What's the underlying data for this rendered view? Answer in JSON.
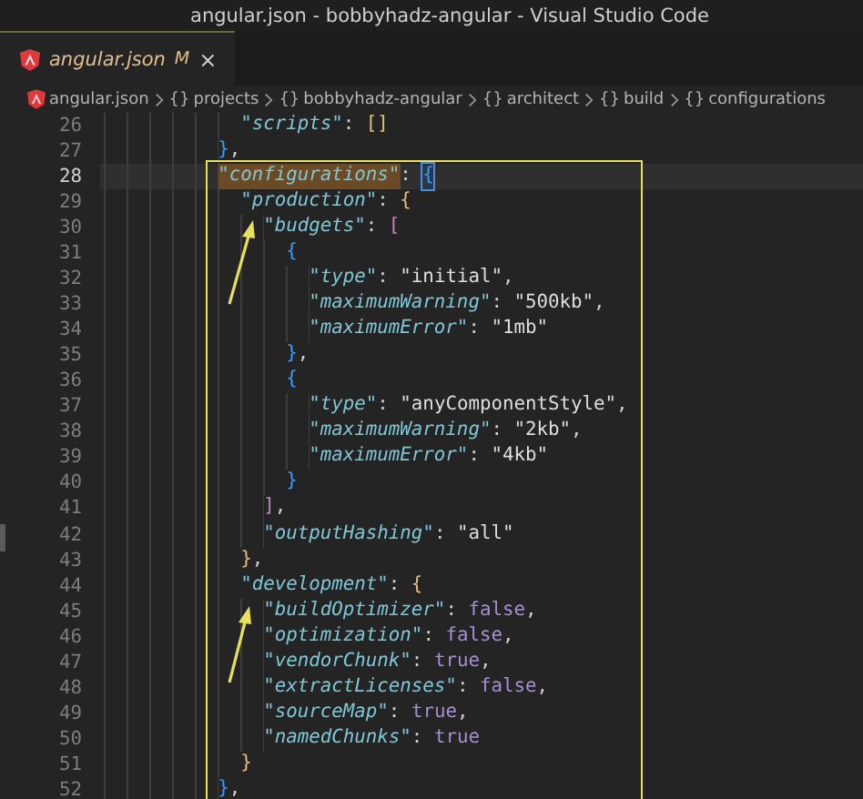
{
  "window": {
    "title": "angular.json - bobbyhadz-angular - Visual Studio Code"
  },
  "tabs": [
    {
      "label": "angular.json",
      "status": "M",
      "close": "×",
      "selected": true,
      "modified": true
    }
  ],
  "breadcrumbs": [
    {
      "kind": "file",
      "label": "angular.json"
    },
    {
      "kind": "symbol",
      "symbol": "{}",
      "label": "projects"
    },
    {
      "kind": "symbol",
      "symbol": "{}",
      "label": "bobbyhadz-angular"
    },
    {
      "kind": "symbol",
      "symbol": "{}",
      "label": "architect"
    },
    {
      "kind": "symbol",
      "symbol": "{}",
      "label": "build"
    },
    {
      "kind": "symbol",
      "symbol": "{}",
      "label": "configurations"
    }
  ],
  "editor": {
    "lines": [
      {
        "number": "26",
        "current": false,
        "tokens": [
          {
            "kind": "key",
            "text": "            \"scripts\""
          },
          {
            "kind": "punct",
            "text": ": "
          },
          {
            "kind": "bracket",
            "text": "[]",
            "color": "#e5c07b"
          }
        ]
      },
      {
        "number": "27",
        "current": false,
        "tokens": [
          {
            "kind": "bracket",
            "text": "          }",
            "color": "#3b9cff"
          },
          {
            "kind": "punct",
            "text": ","
          }
        ]
      },
      {
        "number": "28",
        "current": true,
        "tokens": [
          {
            "kind": "match",
            "text": "          \"configurations\""
          },
          {
            "kind": "punct",
            "text": ": "
          },
          {
            "kind": "cursor",
            "text": "{",
            "color": "#3b9cff"
          }
        ]
      },
      {
        "number": "29",
        "current": false,
        "tokens": [
          {
            "kind": "key",
            "text": "            \"production\""
          },
          {
            "kind": "punct",
            "text": ": "
          },
          {
            "kind": "bracket",
            "text": "{",
            "color": "#e5c07b"
          }
        ]
      },
      {
        "number": "30",
        "current": false,
        "tokens": [
          {
            "kind": "key",
            "text": "              \"budgets\""
          },
          {
            "kind": "punct",
            "text": ": "
          },
          {
            "kind": "bracket",
            "text": "[",
            "color": "#c586c0"
          }
        ]
      },
      {
        "number": "31",
        "current": false,
        "tokens": [
          {
            "kind": "bracket",
            "text": "                {",
            "color": "#3b9cff"
          }
        ]
      },
      {
        "number": "32",
        "current": false,
        "tokens": [
          {
            "kind": "key",
            "text": "                  \"type\""
          },
          {
            "kind": "punct",
            "text": ": "
          },
          {
            "kind": "string",
            "text": "\"initial\""
          },
          {
            "kind": "punct",
            "text": ","
          }
        ]
      },
      {
        "number": "33",
        "current": false,
        "tokens": [
          {
            "kind": "key",
            "text": "                  \"maximumWarning\""
          },
          {
            "kind": "punct",
            "text": ": "
          },
          {
            "kind": "string",
            "text": "\"500kb\""
          },
          {
            "kind": "punct",
            "text": ","
          }
        ]
      },
      {
        "number": "34",
        "current": false,
        "tokens": [
          {
            "kind": "key",
            "text": "                  \"maximumError\""
          },
          {
            "kind": "punct",
            "text": ": "
          },
          {
            "kind": "string",
            "text": "\"1mb\""
          }
        ]
      },
      {
        "number": "35",
        "current": false,
        "tokens": [
          {
            "kind": "bracket",
            "text": "                }",
            "color": "#3b9cff"
          },
          {
            "kind": "punct",
            "text": ","
          }
        ]
      },
      {
        "number": "36",
        "current": false,
        "tokens": [
          {
            "kind": "bracket",
            "text": "                {",
            "color": "#3b9cff"
          }
        ]
      },
      {
        "number": "37",
        "current": false,
        "tokens": [
          {
            "kind": "key",
            "text": "                  \"type\""
          },
          {
            "kind": "punct",
            "text": ": "
          },
          {
            "kind": "string",
            "text": "\"anyComponentStyle\""
          },
          {
            "kind": "punct",
            "text": ","
          }
        ]
      },
      {
        "number": "38",
        "current": false,
        "tokens": [
          {
            "kind": "key",
            "text": "                  \"maximumWarning\""
          },
          {
            "kind": "punct",
            "text": ": "
          },
          {
            "kind": "string",
            "text": "\"2kb\""
          },
          {
            "kind": "punct",
            "text": ","
          }
        ]
      },
      {
        "number": "39",
        "current": false,
        "tokens": [
          {
            "kind": "key",
            "text": "                  \"maximumError\""
          },
          {
            "kind": "punct",
            "text": ": "
          },
          {
            "kind": "string",
            "text": "\"4kb\""
          }
        ]
      },
      {
        "number": "40",
        "current": false,
        "tokens": [
          {
            "kind": "bracket",
            "text": "                }",
            "color": "#3b9cff"
          }
        ]
      },
      {
        "number": "41",
        "current": false,
        "tokens": [
          {
            "kind": "bracket",
            "text": "              ]",
            "color": "#c586c0"
          },
          {
            "kind": "punct",
            "text": ","
          }
        ]
      },
      {
        "number": "42",
        "current": false,
        "tokens": [
          {
            "kind": "key",
            "text": "              \"outputHashing\""
          },
          {
            "kind": "punct",
            "text": ": "
          },
          {
            "kind": "string",
            "text": "\"all\""
          }
        ]
      },
      {
        "number": "43",
        "current": false,
        "tokens": [
          {
            "kind": "bracket",
            "text": "            }",
            "color": "#e5c07b"
          },
          {
            "kind": "punct",
            "text": ","
          }
        ]
      },
      {
        "number": "44",
        "current": false,
        "tokens": [
          {
            "kind": "key",
            "text": "            \"development\""
          },
          {
            "kind": "punct",
            "text": ": "
          },
          {
            "kind": "bracket",
            "text": "{",
            "color": "#e5c07b"
          }
        ]
      },
      {
        "number": "45",
        "current": false,
        "tokens": [
          {
            "kind": "key",
            "text": "              \"buildOptimizer\""
          },
          {
            "kind": "punct",
            "text": ": "
          },
          {
            "kind": "literal",
            "text": "false"
          },
          {
            "kind": "punct",
            "text": ","
          }
        ]
      },
      {
        "number": "46",
        "current": false,
        "tokens": [
          {
            "kind": "key",
            "text": "              \"optimization\""
          },
          {
            "kind": "punct",
            "text": ": "
          },
          {
            "kind": "literal",
            "text": "false"
          },
          {
            "kind": "punct",
            "text": ","
          }
        ]
      },
      {
        "number": "47",
        "current": false,
        "tokens": [
          {
            "kind": "key",
            "text": "              \"vendorChunk\""
          },
          {
            "kind": "punct",
            "text": ": "
          },
          {
            "kind": "literal",
            "text": "true"
          },
          {
            "kind": "punct",
            "text": ","
          }
        ]
      },
      {
        "number": "48",
        "current": false,
        "tokens": [
          {
            "kind": "key",
            "text": "              \"extractLicenses\""
          },
          {
            "kind": "punct",
            "text": ": "
          },
          {
            "kind": "literal",
            "text": "false"
          },
          {
            "kind": "punct",
            "text": ","
          }
        ]
      },
      {
        "number": "49",
        "current": false,
        "tokens": [
          {
            "kind": "key",
            "text": "              \"sourceMap\""
          },
          {
            "kind": "punct",
            "text": ": "
          },
          {
            "kind": "literal",
            "text": "true"
          },
          {
            "kind": "punct",
            "text": ","
          }
        ]
      },
      {
        "number": "50",
        "current": false,
        "tokens": [
          {
            "kind": "key",
            "text": "              \"namedChunks\""
          },
          {
            "kind": "punct",
            "text": ": "
          },
          {
            "kind": "literal",
            "text": "true"
          }
        ]
      },
      {
        "number": "51",
        "current": false,
        "tokens": [
          {
            "kind": "bracket",
            "text": "            }",
            "color": "#e5c07b"
          }
        ]
      },
      {
        "number": "52",
        "current": false,
        "tokens": [
          {
            "kind": "bracket",
            "text": "          }",
            "color": "#3b9cff"
          },
          {
            "kind": "punct",
            "text": ","
          }
        ]
      }
    ]
  }
}
